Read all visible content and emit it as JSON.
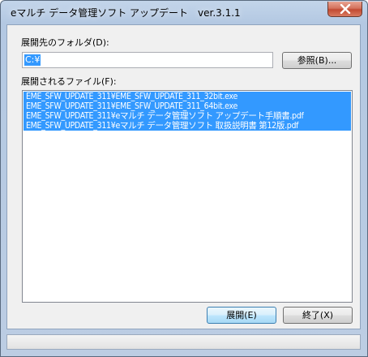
{
  "window": {
    "title": "eマルチ データ管理ソフト アップデート　ver.3.1.1"
  },
  "folder": {
    "label": "展開先のフォルダ(D):",
    "value": "C:¥",
    "browse_label": "参照(B)..."
  },
  "files": {
    "label": "展開されるファイル(F):",
    "items": [
      "EME_SFW_UPDATE_311¥EME_SFW_UPDATE_311_32bit.exe",
      "EME_SFW_UPDATE_311¥EME_SFW_UPDATE_311_64bit.exe",
      "EME_SFW_UPDATE_311¥eマルチ データ管理ソフト アップデート手順書.pdf",
      "EME_SFW_UPDATE_311¥eマルチ データ管理ソフト 取扱説明書 第12版.pdf"
    ]
  },
  "buttons": {
    "extract_label": "展開(E)",
    "exit_label": "終了(X)"
  },
  "colors": {
    "selection": "#3399ff",
    "close_button": "#c24a32"
  }
}
